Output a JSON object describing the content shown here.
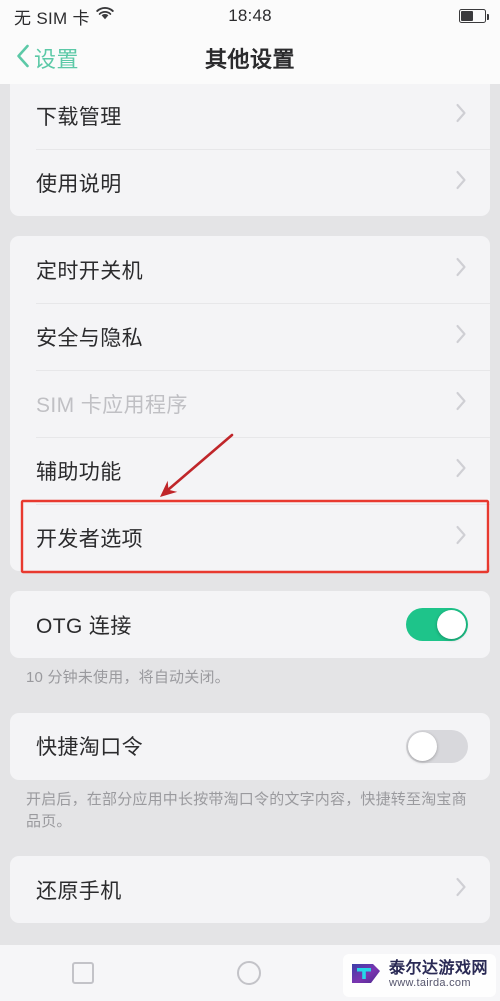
{
  "statusbar": {
    "carrier": "无 SIM 卡",
    "wifi_icon": "wifi-icon",
    "time": "18:48",
    "battery_icon": "battery-icon",
    "battery_level_pct": 52
  },
  "navbar": {
    "back_icon": "chevron-left-icon",
    "back_label": "设置",
    "title": "其他设置"
  },
  "groups": [
    {
      "id": "group-downloads",
      "clipped_top": true,
      "rows": [
        {
          "id": "row-download-manager",
          "label": "下载管理",
          "type": "link",
          "accessory": "chevron-right-icon",
          "disabled": false
        },
        {
          "id": "row-user-guide",
          "label": "使用说明",
          "type": "link",
          "accessory": "chevron-right-icon",
          "disabled": false
        }
      ]
    },
    {
      "id": "group-system",
      "clipped_top": false,
      "rows": [
        {
          "id": "row-scheduled-power",
          "label": "定时开关机",
          "type": "link",
          "accessory": "chevron-right-icon",
          "disabled": false
        },
        {
          "id": "row-security-privacy",
          "label": "安全与隐私",
          "type": "link",
          "accessory": "chevron-right-icon",
          "disabled": false
        },
        {
          "id": "row-sim-toolkit",
          "label": "SIM 卡应用程序",
          "type": "link",
          "accessory": "chevron-right-icon",
          "disabled": true
        },
        {
          "id": "row-accessibility",
          "label": "辅助功能",
          "type": "link",
          "accessory": "chevron-right-icon",
          "disabled": false
        },
        {
          "id": "row-developer-options",
          "label": "开发者选项",
          "type": "link",
          "accessory": "chevron-right-icon",
          "disabled": false,
          "highlighted": true
        }
      ]
    },
    {
      "id": "group-otg",
      "clipped_top": false,
      "rows": [
        {
          "id": "row-otg",
          "label": "OTG 连接",
          "type": "switch",
          "switch_state": "on"
        }
      ],
      "helper": "10 分钟未使用，将自动关闭。"
    },
    {
      "id": "group-taokouling",
      "clipped_top": false,
      "rows": [
        {
          "id": "row-quick-taokouling",
          "label": "快捷淘口令",
          "type": "switch",
          "switch_state": "off"
        }
      ],
      "helper": "开启后，在部分应用中长按带淘口令的文字内容，快捷转至淘宝商品页。"
    },
    {
      "id": "group-reset",
      "clipped_top": false,
      "rows": [
        {
          "id": "row-reset-phone",
          "label": "还原手机",
          "type": "link",
          "accessory": "chevron-right-icon",
          "disabled": false
        }
      ]
    }
  ],
  "annotation": {
    "highlight_target": "开发者选项",
    "box_color": "#e8392f",
    "arrow_color": "#c0262a"
  },
  "bottom_nav": [
    {
      "id": "nav-recents",
      "icon": "square-icon"
    },
    {
      "id": "nav-home",
      "icon": "circle-icon"
    },
    {
      "id": "nav-back",
      "icon": "back-triangle-icon"
    }
  ],
  "watermark": {
    "name": "泰尔达游戏网",
    "url": "www.tairda.com",
    "logo_icon": "tairda-logo-icon"
  },
  "colors": {
    "accent_green": "#5cc9a7",
    "switch_on": "#1ec48a",
    "switch_off": "#d8d8dc",
    "page_bg": "#e4e4e6",
    "card_bg": "#f4f4f6",
    "highlight_red": "#e8392f"
  }
}
